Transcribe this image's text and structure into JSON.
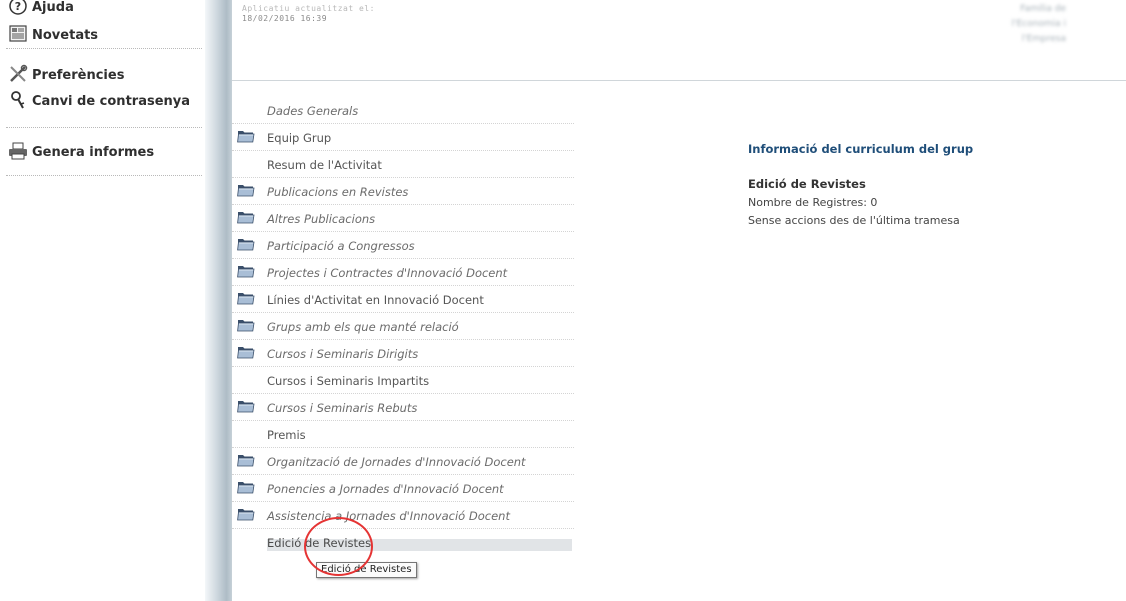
{
  "sidebar": {
    "items": [
      {
        "label": "Ajuda",
        "icon": "help-icon"
      },
      {
        "label": "Novetats",
        "icon": "news-icon"
      },
      {
        "label": "Preferències",
        "icon": "tools-icon"
      },
      {
        "label": "Canvi de contrasenya",
        "icon": "key-icon"
      },
      {
        "label": "Genera informes",
        "icon": "printer-icon"
      }
    ]
  },
  "header": {
    "updated_label": "Aplicatiu actualitzat el:",
    "updated_value": "18/02/2016 16:39",
    "blurred_lines": [
      "Família de",
      "l'Economia i",
      "l'Empresa"
    ]
  },
  "sections": [
    {
      "label": "Dades Generals",
      "folder": false,
      "italic": true
    },
    {
      "label": "Equip Grup",
      "folder": true,
      "italic": false
    },
    {
      "label": "Resum de l'Activitat",
      "folder": false,
      "italic": false
    },
    {
      "label": "Publicacions en Revistes",
      "folder": true,
      "italic": true
    },
    {
      "label": "Altres Publicacions",
      "folder": true,
      "italic": true
    },
    {
      "label": "Participació a Congressos",
      "folder": true,
      "italic": true
    },
    {
      "label": "Projectes i Contractes d'Innovació Docent",
      "folder": true,
      "italic": true
    },
    {
      "label": "Línies d'Activitat en Innovació Docent",
      "folder": true,
      "italic": false
    },
    {
      "label": "Grups amb els que manté relació",
      "folder": true,
      "italic": true
    },
    {
      "label": "Cursos i Seminaris Dirigits",
      "folder": true,
      "italic": true
    },
    {
      "label": "Cursos i Seminaris Impartits",
      "folder": false,
      "italic": false
    },
    {
      "label": "Cursos i Seminaris Rebuts",
      "folder": true,
      "italic": true
    },
    {
      "label": "Premis",
      "folder": false,
      "italic": false
    },
    {
      "label": "Organització de Jornades d'Innovació Docent",
      "folder": true,
      "italic": true
    },
    {
      "label": "Ponencies a Jornades d'Innovació Docent",
      "folder": true,
      "italic": true
    },
    {
      "label": "Assistencia a Jornades d'Innovació Docent",
      "folder": true,
      "italic": true
    },
    {
      "label": "Edició de Revistes",
      "folder": false,
      "italic": false,
      "highlighted": true
    }
  ],
  "info": {
    "title": "Informació del curriculum del grup",
    "subtitle": "Edició de Revistes",
    "records": "Nombre de Registres: 0",
    "status": "Sense accions des de l'última tramesa"
  },
  "tooltip": {
    "text": "Edició de Revistes"
  },
  "colors": {
    "info_title": "#1f4e79",
    "annotation": "#e53434",
    "highlight": "#e1e4e7"
  }
}
